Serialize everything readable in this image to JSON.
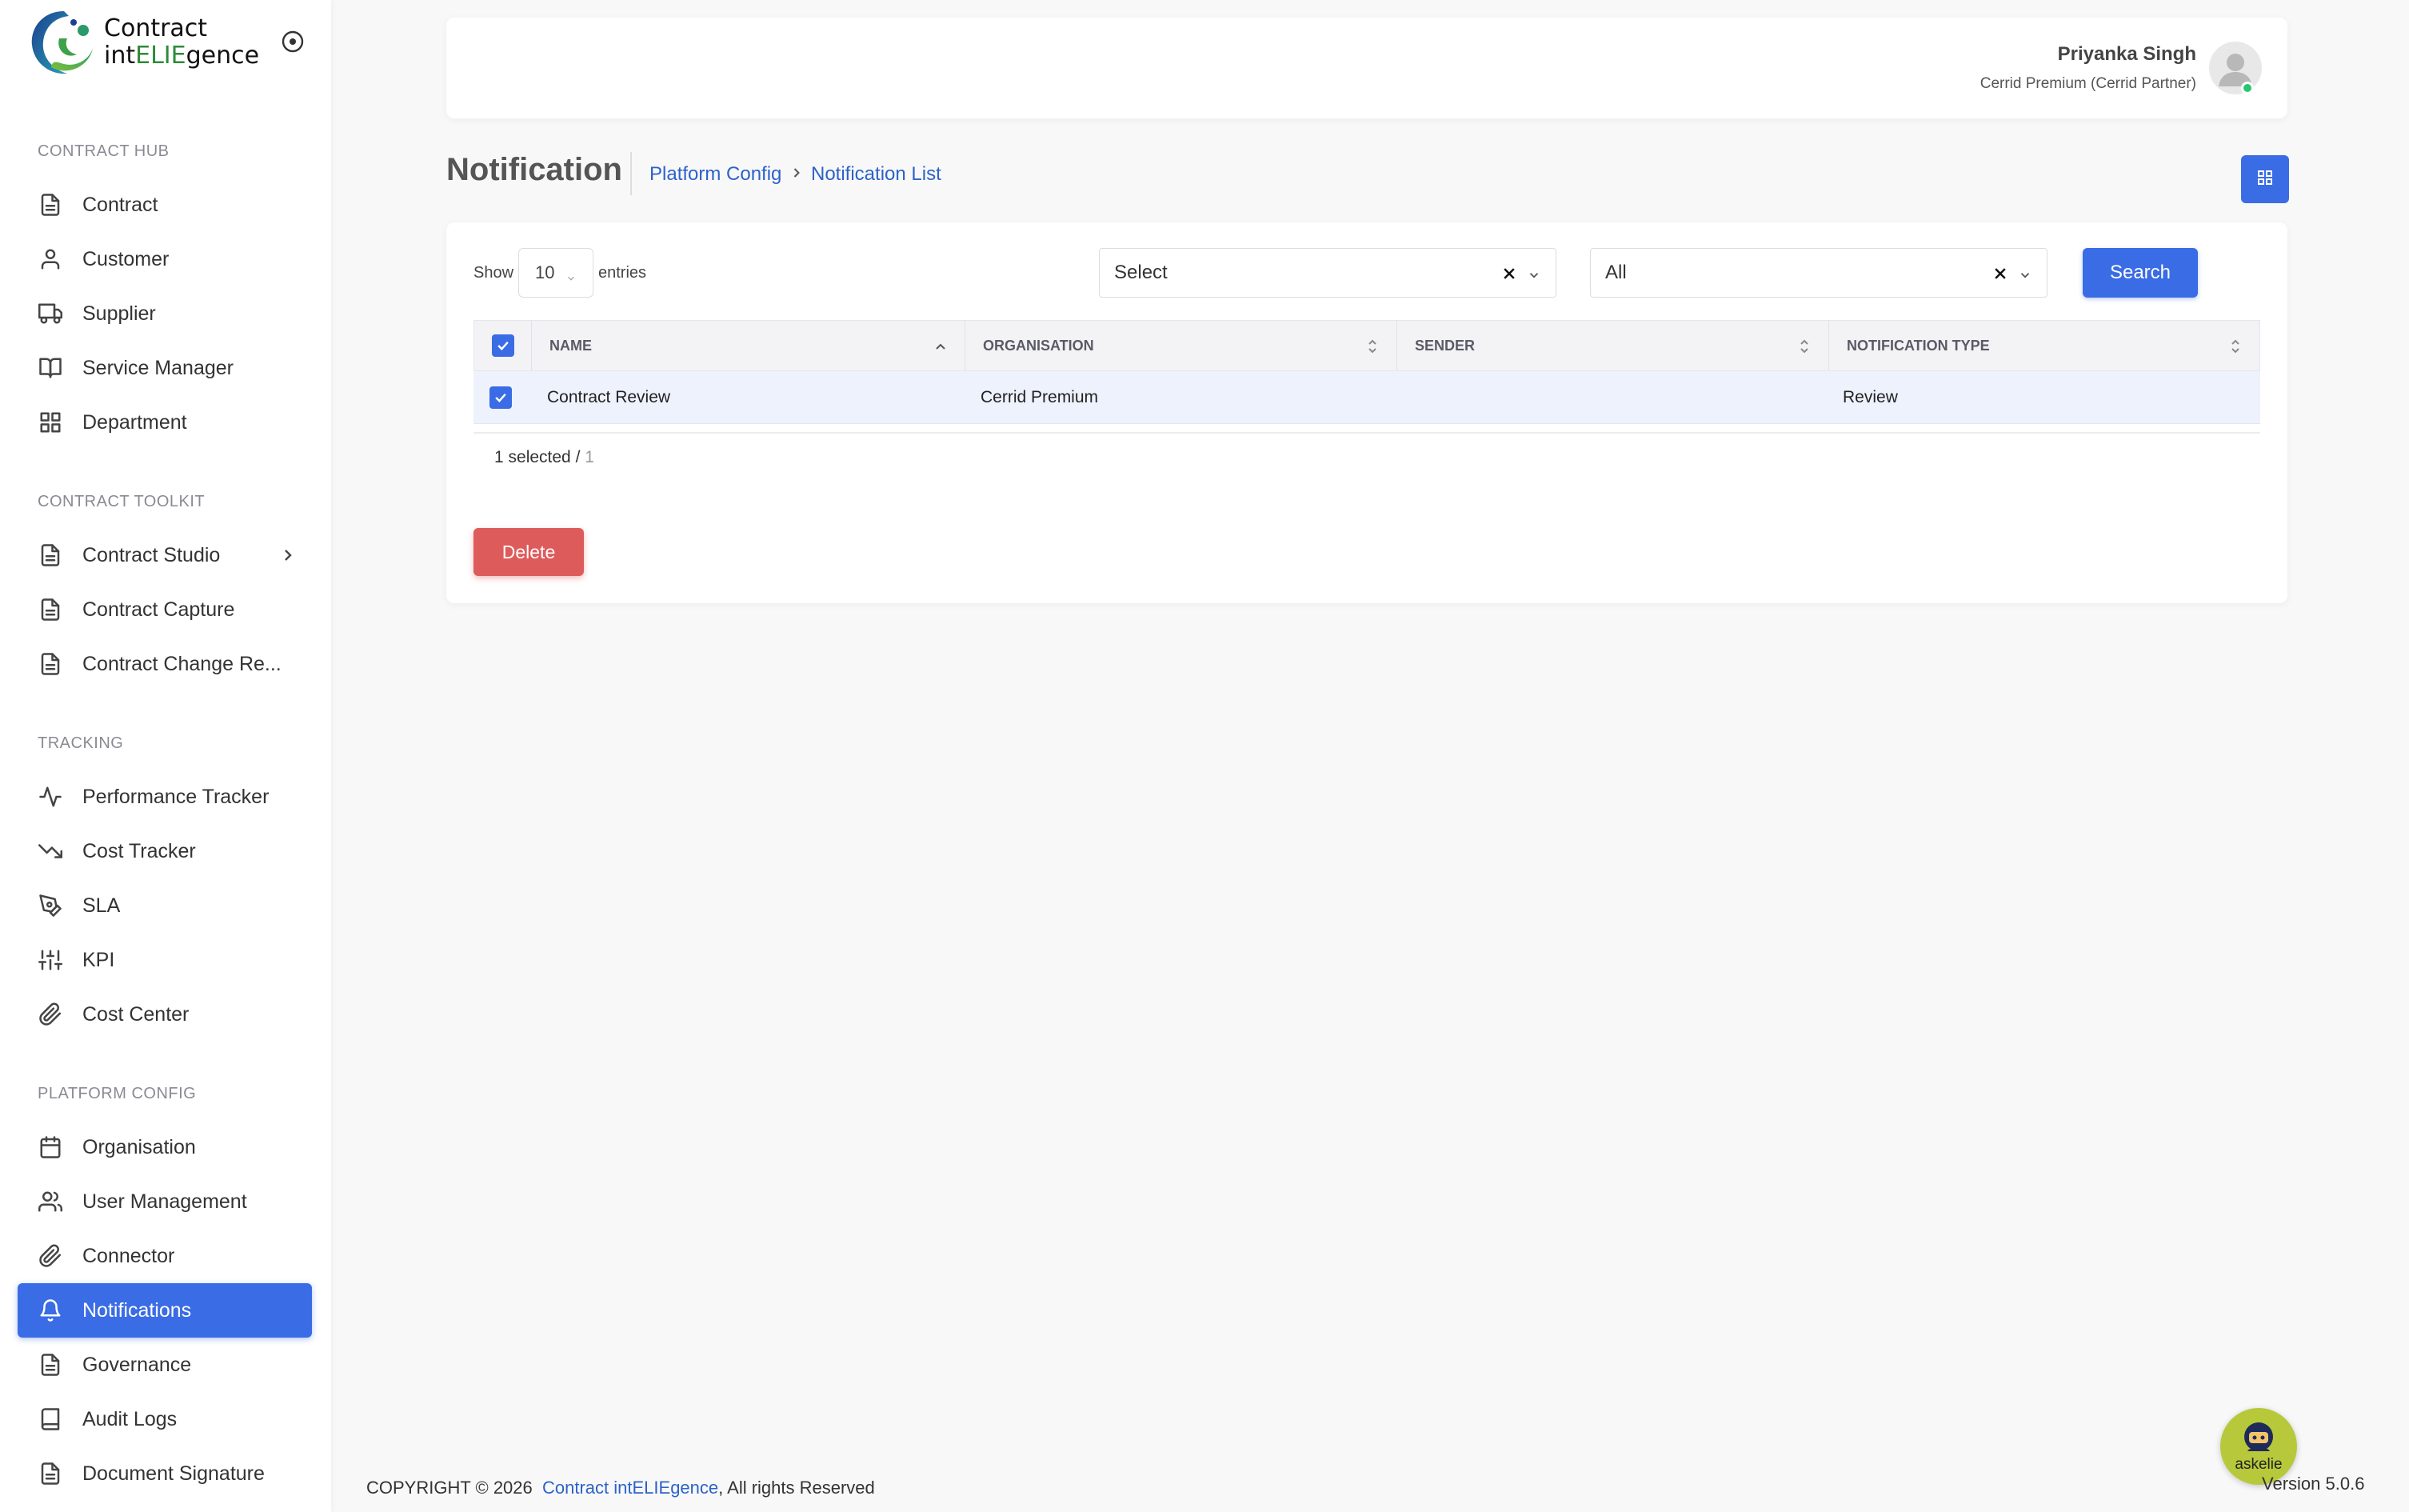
{
  "app": {
    "logo_line1": "Contract",
    "logo_line2_prefix": "int",
    "logo_line2_highlight": "ELIE",
    "logo_line2_suffix": "gence"
  },
  "sidebar": {
    "sections": [
      {
        "label": "CONTRACT HUB"
      },
      {
        "label": "CONTRACT TOOLKIT"
      },
      {
        "label": "TRACKING"
      },
      {
        "label": "PLATFORM CONFIG"
      }
    ],
    "items": [
      {
        "label": "Contract",
        "icon": "document-icon"
      },
      {
        "label": "Customer",
        "icon": "user-icon"
      },
      {
        "label": "Supplier",
        "icon": "truck-icon"
      },
      {
        "label": "Service Manager",
        "icon": "book-icon"
      },
      {
        "label": "Department",
        "icon": "grid-icon"
      },
      {
        "label": "Contract Studio",
        "icon": "document-icon"
      },
      {
        "label": "Contract Capture",
        "icon": "document-icon"
      },
      {
        "label": "Contract Change Re...",
        "icon": "document-icon"
      },
      {
        "label": "Performance Tracker",
        "icon": "activity-icon"
      },
      {
        "label": "Cost Tracker",
        "icon": "trending-down-icon"
      },
      {
        "label": "SLA",
        "icon": "pen-tool-icon"
      },
      {
        "label": "KPI",
        "icon": "sliders-icon"
      },
      {
        "label": "Cost Center",
        "icon": "paperclip-icon"
      },
      {
        "label": "Organisation",
        "icon": "calendar-icon"
      },
      {
        "label": "User Management",
        "icon": "users-icon"
      },
      {
        "label": "Connector",
        "icon": "paperclip-icon"
      },
      {
        "label": "Notifications",
        "icon": "bell-icon"
      },
      {
        "label": "Governance",
        "icon": "document-icon"
      },
      {
        "label": "Audit Logs",
        "icon": "book-icon"
      },
      {
        "label": "Document Signature",
        "icon": "document-icon"
      }
    ],
    "active_item": "Notifications"
  },
  "header": {
    "user_name": "Priyanka Singh",
    "user_org": "Cerrid Premium (Cerrid Partner)"
  },
  "page": {
    "title": "Notification",
    "breadcrumb": [
      "Platform Config",
      "Notification List"
    ]
  },
  "controls": {
    "show_label": "Show",
    "entries_value": "10",
    "entries_label": "entries",
    "filter1_value": "Select",
    "filter2_value": "All",
    "search_label": "Search"
  },
  "table": {
    "columns": [
      "NAME",
      "ORGANISATION",
      "SENDER",
      "NOTIFICATION TYPE"
    ],
    "rows": [
      {
        "name": "Contract Review",
        "organisation": "Cerrid Premium",
        "sender": "",
        "notification_type": "Review",
        "selected": true
      }
    ],
    "selected_text": "1 selected / ",
    "total_text": "1"
  },
  "actions": {
    "delete_label": "Delete"
  },
  "footer": {
    "copyright_prefix": "COPYRIGHT © 2026",
    "brand": "Contract intELIEgence",
    "suffix": ", All rights Reserved",
    "version": "Version 5.0.6",
    "assistant_label": "askelie"
  },
  "colors": {
    "primary": "#3a6ce5",
    "danger": "#de5b5b",
    "link": "#2d62c9",
    "online": "#28c76f"
  }
}
